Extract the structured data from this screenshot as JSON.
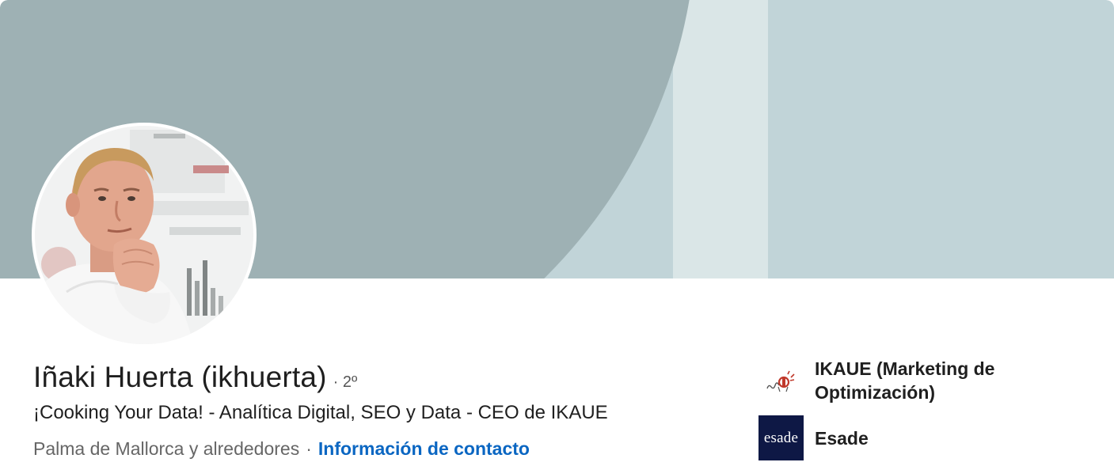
{
  "profile": {
    "name": "Iñaki Huerta (ikhuerta)",
    "degree": "· 2º",
    "headline": "¡Cooking Your Data! - Analítica Digital, SEO y Data - CEO de IKAUE",
    "location": "Palma de Mallorca y alrededores",
    "separator": "·",
    "contact_link": "Información de contacto"
  },
  "organizations": [
    {
      "name": "IKAUE (Marketing de Optimización)",
      "logo_icon": "ikaue-logo-icon"
    },
    {
      "name": "Esade",
      "logo_text": "esade",
      "logo_icon": "esade-logo-icon"
    }
  ],
  "colors": {
    "banner_light": "#c1d4d8",
    "banner_dark": "#9eb1b4",
    "link": "#0a66c2",
    "esade_navy": "#0e1845"
  }
}
